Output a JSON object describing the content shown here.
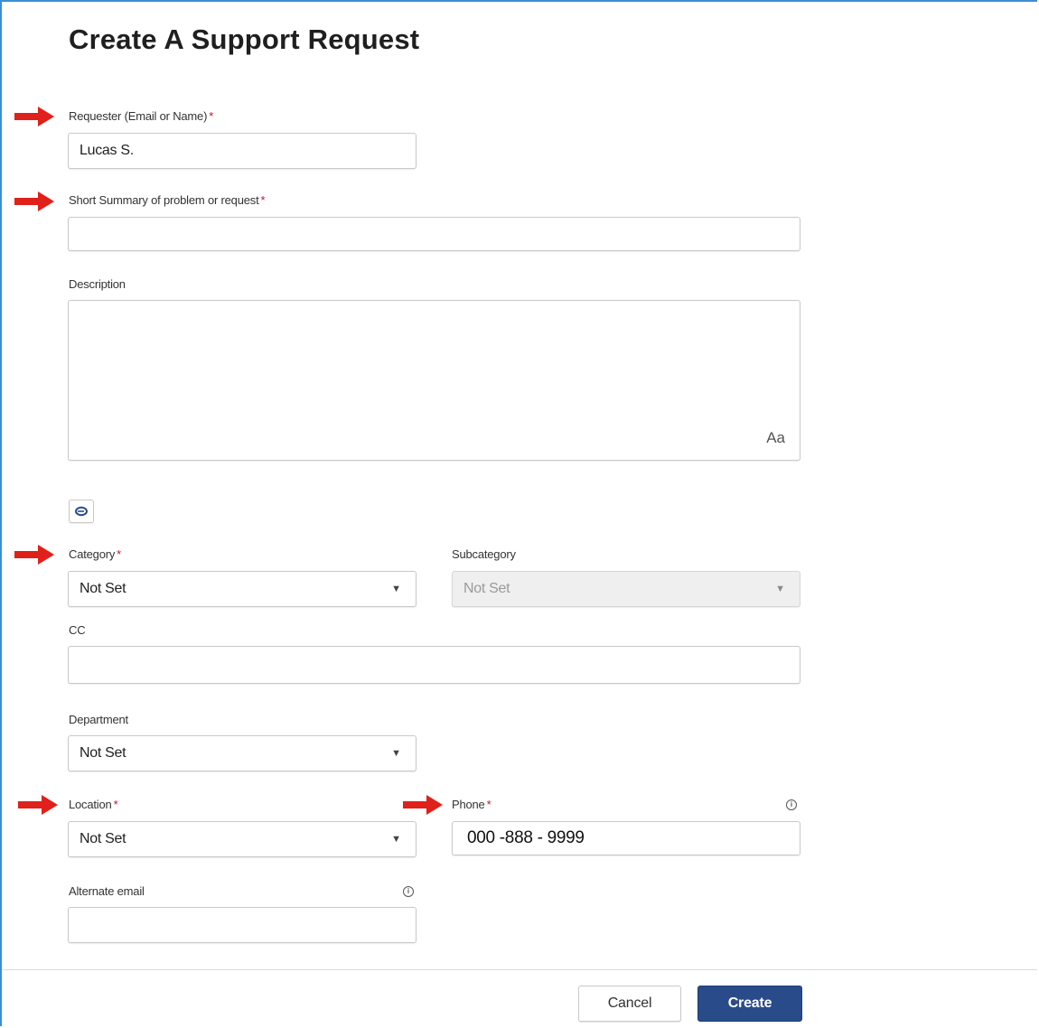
{
  "title": "Create A Support Request",
  "required_marker": "*",
  "fields": {
    "requester": {
      "label": "Requester (Email or Name)",
      "value": "Lucas S."
    },
    "summary": {
      "label": "Short Summary of problem or request",
      "value": ""
    },
    "description": {
      "label": "Description",
      "value": "",
      "format_icon_label": "Aa"
    },
    "category": {
      "label": "Category",
      "value": "Not Set"
    },
    "subcategory": {
      "label": "Subcategory",
      "value": "Not Set"
    },
    "cc": {
      "label": "CC",
      "value": ""
    },
    "department": {
      "label": "Department",
      "value": "Not Set"
    },
    "location": {
      "label": "Location",
      "value": "Not Set"
    },
    "phone": {
      "label": "Phone",
      "value": "000 -888 - 9999"
    },
    "alternate_email": {
      "label": "Alternate email",
      "value": ""
    }
  },
  "info_icon_glyph": "i",
  "caret_glyph": "▼",
  "buttons": {
    "cancel": "Cancel",
    "create": "Create"
  },
  "colors": {
    "arrow": "#e0201a",
    "required": "#c8102e",
    "primary_button": "#2a4b8a",
    "frame": "#3a8fd6"
  }
}
